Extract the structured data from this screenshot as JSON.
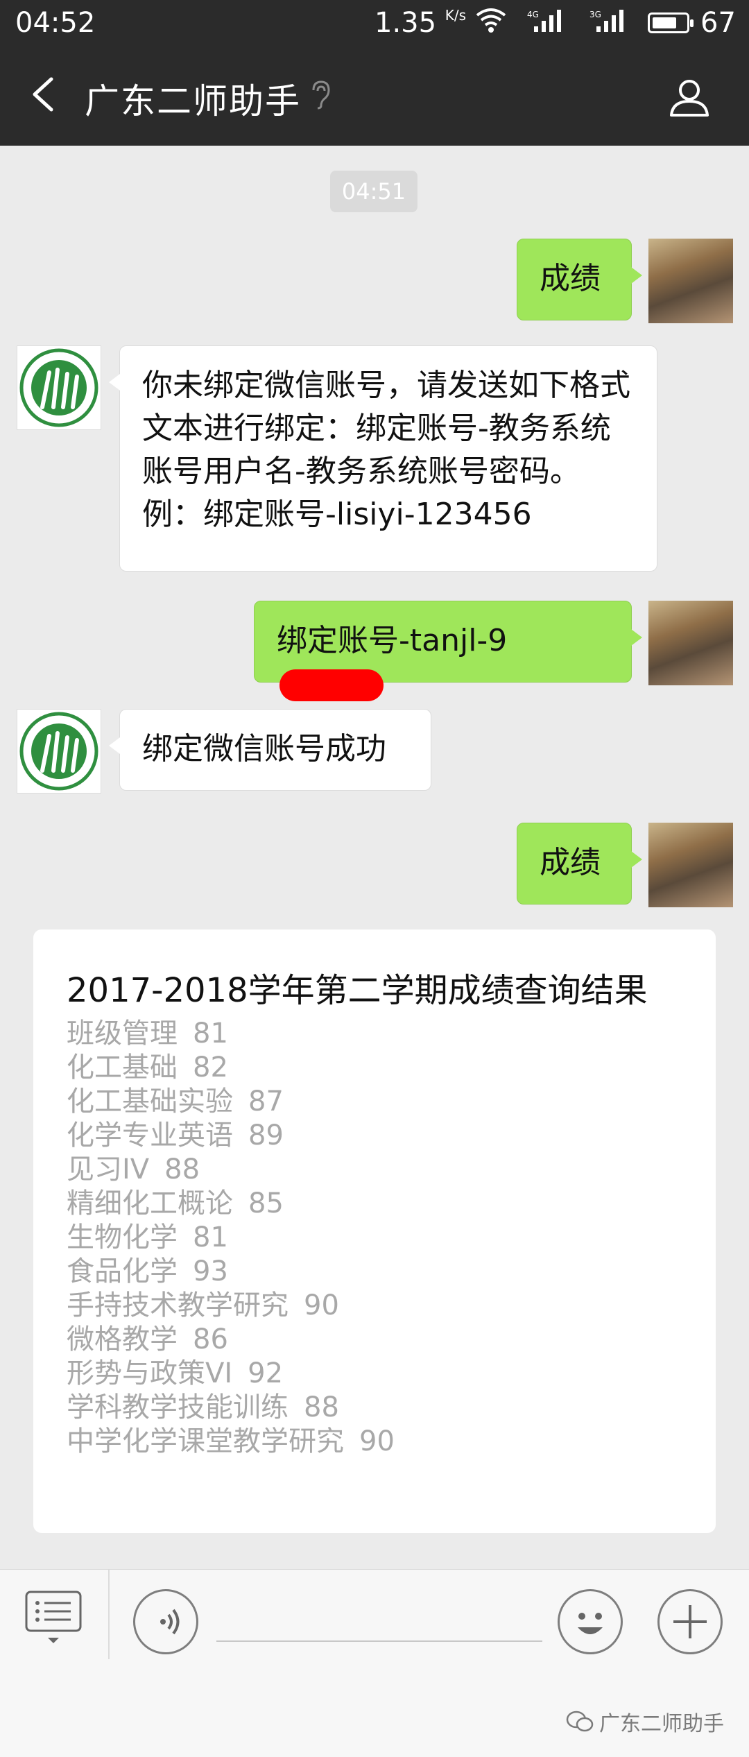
{
  "status_bar": {
    "time": "04:52",
    "speed_value": "1.35",
    "speed_unit": "K/s",
    "net_tag_1": "4G",
    "net_tag_2": "3G",
    "battery": "67"
  },
  "header": {
    "title": "广东二师助手",
    "back_icon": "chevron-left-icon",
    "profile_icon": "person-icon"
  },
  "chat": {
    "timestamp": "04:51",
    "messages": [
      {
        "from": "me",
        "text": "成绩"
      },
      {
        "from": "bot",
        "text": "你未绑定微信账号，请发送如下格式文本进行绑定：绑定账号-教务系统账号用户名-教务系统账号密码。例：绑定账号-lisiyi-123456"
      },
      {
        "from": "me",
        "text": "绑定账号-tanjl-9"
      },
      {
        "from": "bot",
        "text": "绑定微信账号成功"
      },
      {
        "from": "me",
        "text": "成绩"
      }
    ]
  },
  "result_card": {
    "title": "2017-2018学年第二学期成绩查询结果",
    "grades": [
      {
        "course": "班级管理",
        "score": "81"
      },
      {
        "course": "化工基础",
        "score": "82"
      },
      {
        "course": "化工基础实验",
        "score": "87"
      },
      {
        "course": "化学专业英语",
        "score": "89"
      },
      {
        "course": "见习IV",
        "score": "88"
      },
      {
        "course": "精细化工概论",
        "score": "85"
      },
      {
        "course": "生物化学",
        "score": "81"
      },
      {
        "course": "食品化学",
        "score": "93"
      },
      {
        "course": "手持技术教学研究",
        "score": "90"
      },
      {
        "course": "微格教学",
        "score": "86"
      },
      {
        "course": "形势与政策VI",
        "score": "92"
      },
      {
        "course": "学科教学技能训练",
        "score": "88"
      },
      {
        "course": "中学化学课堂教学研究",
        "score": "90"
      }
    ]
  },
  "input_bar": {
    "menu_icon": "list-menu-icon",
    "voice_icon": "voice-icon",
    "emoji_icon": "smiley-icon",
    "plus_icon": "plus-icon"
  },
  "watermark": "广东二师助手",
  "colors": {
    "header_bg": "#2b2b2b",
    "chat_bg": "#ebebeb",
    "my_bubble": "#9fe65a",
    "redaction": "#ff0000"
  }
}
